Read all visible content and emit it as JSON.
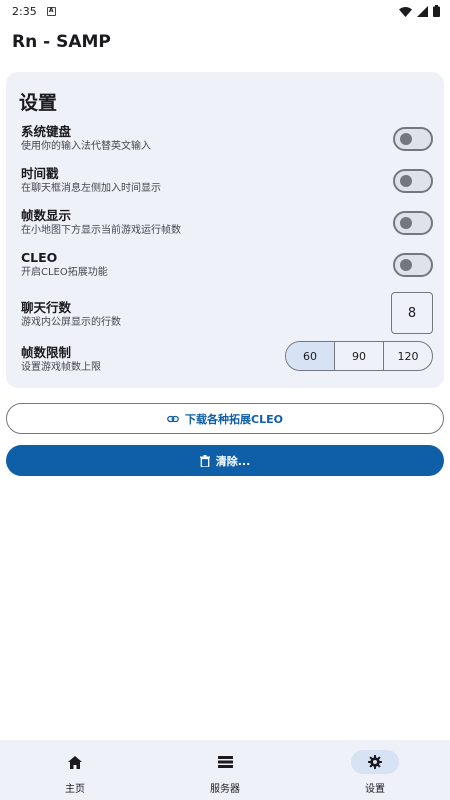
{
  "status_bar": {
    "time": "2:35",
    "app_icon_letter": "A"
  },
  "app_bar": {
    "title": "Rn - SAMP"
  },
  "settings": {
    "title": "设置",
    "system_keyboard": {
      "label": "系统键盘",
      "desc": "使用你的输入法代替英文输入",
      "enabled": false
    },
    "timestamp": {
      "label": "时间戳",
      "desc": "在聊天框消息左侧加入时间显示",
      "enabled": false
    },
    "fps_display": {
      "label": "帧数显示",
      "desc": "在小地图下方显示当前游戏运行帧数",
      "enabled": false
    },
    "cleo": {
      "label": "CLEO",
      "desc": "开启CLEO拓展功能",
      "enabled": false
    },
    "chat_lines": {
      "label": "聊天行数",
      "desc": "游戏内公屏显示的行数",
      "value": "8"
    },
    "fps_limit": {
      "label": "帧数限制",
      "desc": "设置游戏帧数上限",
      "options": [
        "60",
        "90",
        "120"
      ],
      "selected": "60"
    }
  },
  "actions": {
    "download_cleo": "下载各种拓展CLEO",
    "clear": "清除..."
  },
  "bottom_nav": {
    "items": [
      {
        "label": "主页",
        "icon": "home-icon",
        "active": false
      },
      {
        "label": "服务器",
        "icon": "server-list-icon",
        "active": false
      },
      {
        "label": "设置",
        "icon": "gear-icon",
        "active": true
      }
    ]
  },
  "colors": {
    "accent": "#0f5ea8",
    "card_bg": "#eff1f8",
    "selected_bg": "#d8e2f5",
    "outline": "#74777f"
  }
}
